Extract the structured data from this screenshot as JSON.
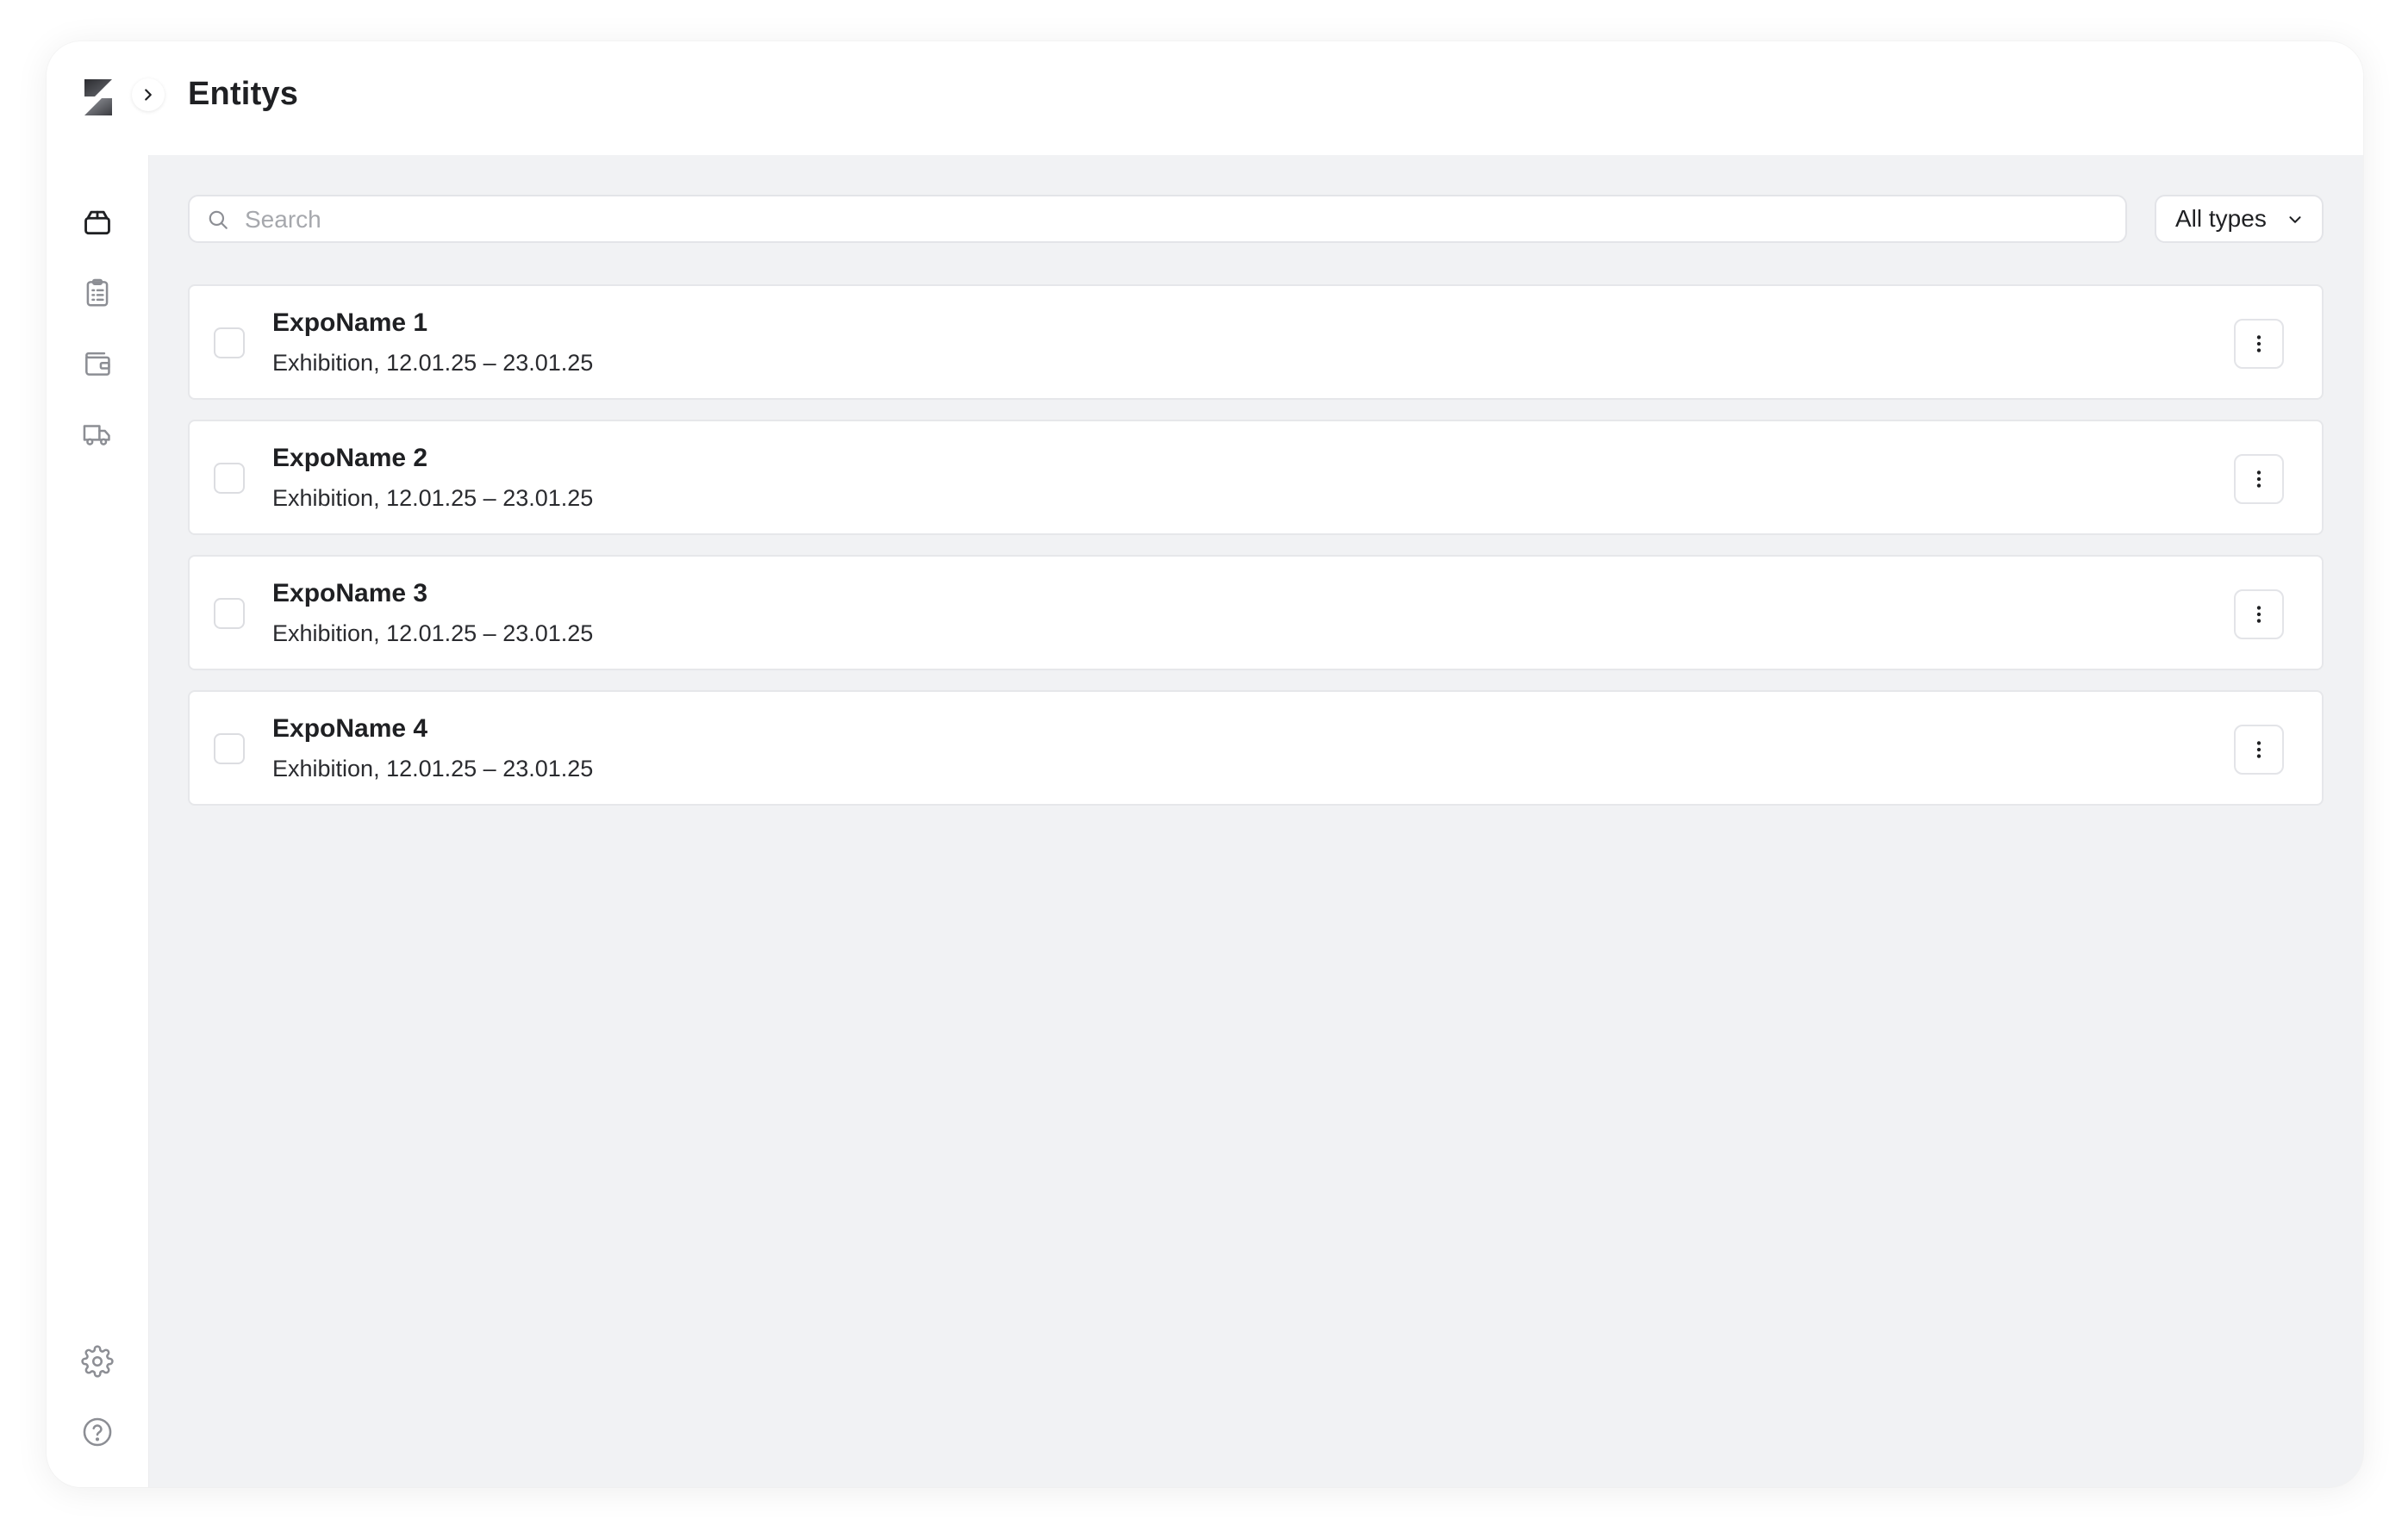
{
  "header": {
    "title": "Entitys"
  },
  "sidebar": {
    "logo": "logo-mark",
    "nav": [
      {
        "icon": "box-icon",
        "active": true
      },
      {
        "icon": "clipboard-list-icon",
        "active": false
      },
      {
        "icon": "wallet-icon",
        "active": false
      },
      {
        "icon": "truck-icon",
        "active": false
      }
    ],
    "bottom": [
      {
        "icon": "gear-icon"
      },
      {
        "icon": "help-icon"
      }
    ],
    "toggle_icon": "chevron-right-icon"
  },
  "toolbar": {
    "search_placeholder": "Search",
    "search_value": "",
    "filter_label": "All types"
  },
  "entities": [
    {
      "name": "ExpoName 1",
      "meta": "Exhibition, 12.01.25 – 23.01.25",
      "checked": false
    },
    {
      "name": "ExpoName 2",
      "meta": "Exhibition, 12.01.25 – 23.01.25",
      "checked": false
    },
    {
      "name": "ExpoName 3",
      "meta": "Exhibition, 12.01.25 – 23.01.25",
      "checked": false
    },
    {
      "name": "ExpoName 4",
      "meta": "Exhibition, 12.01.25 – 23.01.25",
      "checked": false
    }
  ],
  "colors": {
    "accent": "#1f2023",
    "muted_icon": "#8c8e94",
    "background": "#f1f2f4",
    "card_border": "#e6e7ea"
  }
}
